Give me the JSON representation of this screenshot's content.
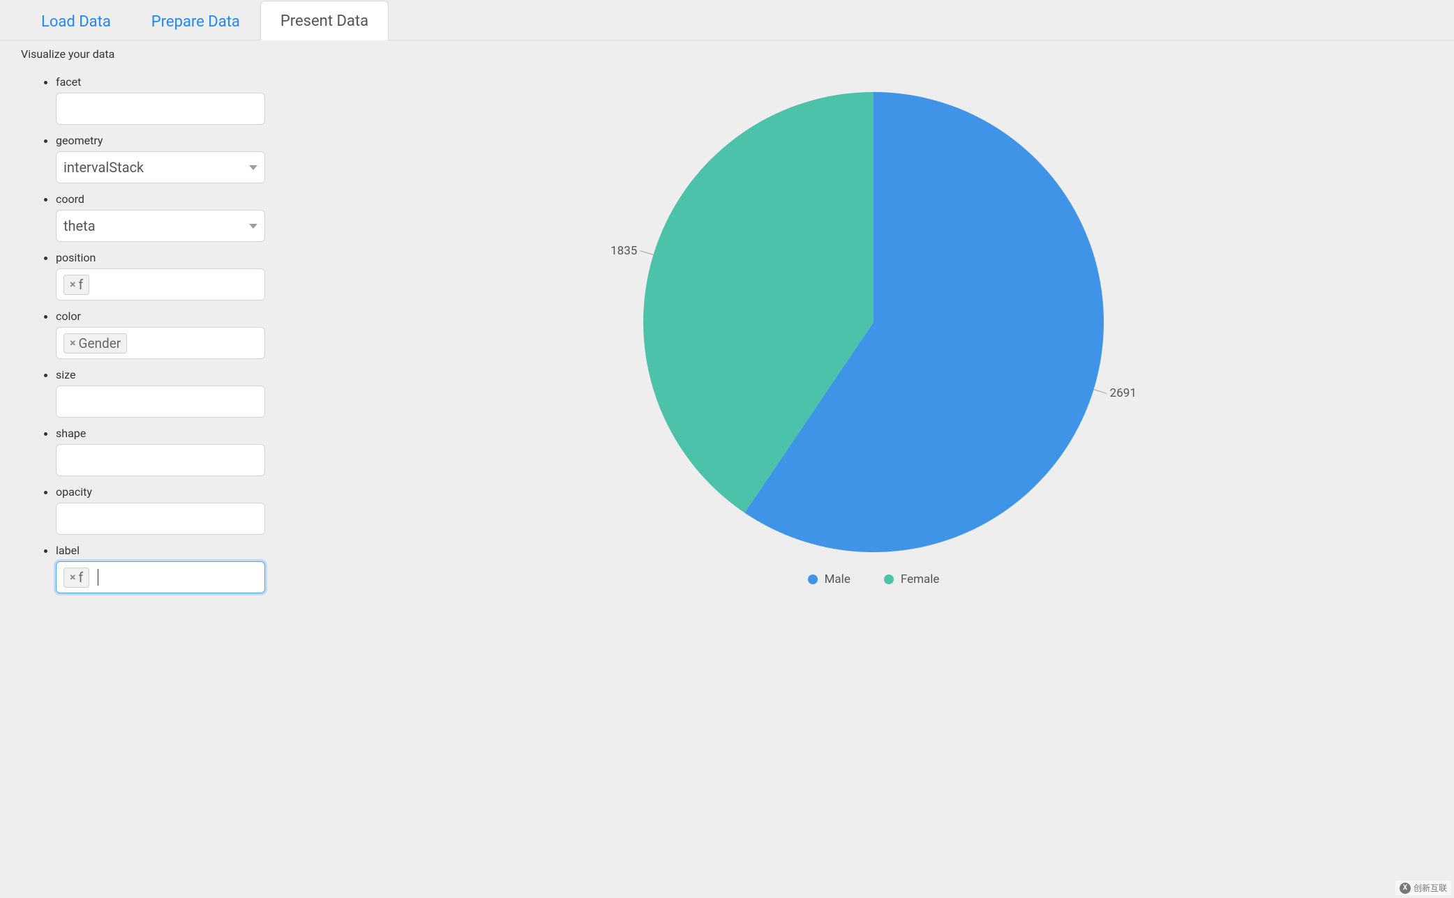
{
  "tabs": {
    "load": "Load Data",
    "prepare": "Prepare Data",
    "present": "Present Data",
    "active": "present"
  },
  "subtitle": "Visualize your data",
  "form": {
    "facet": {
      "label": "facet",
      "value": ""
    },
    "geometry": {
      "label": "geometry",
      "value": "intervalStack"
    },
    "coord": {
      "label": "coord",
      "value": "theta"
    },
    "position": {
      "label": "position",
      "tags": [
        "f"
      ]
    },
    "color": {
      "label": "color",
      "tags": [
        "Gender"
      ]
    },
    "size": {
      "label": "size",
      "value": ""
    },
    "shape": {
      "label": "shape",
      "value": ""
    },
    "opacity": {
      "label": "opacity",
      "value": ""
    },
    "label": {
      "label": "label",
      "tags": [
        "f"
      ],
      "focused": true
    }
  },
  "chart_data": {
    "type": "pie",
    "title": "",
    "series_name": "Gender",
    "categories": [
      "Male",
      "Female"
    ],
    "values": [
      2691,
      1835
    ],
    "colors": {
      "Male": "#3f94e8",
      "Female": "#4dc2ab"
    },
    "legend_position": "bottom"
  },
  "watermark": "创新互联"
}
